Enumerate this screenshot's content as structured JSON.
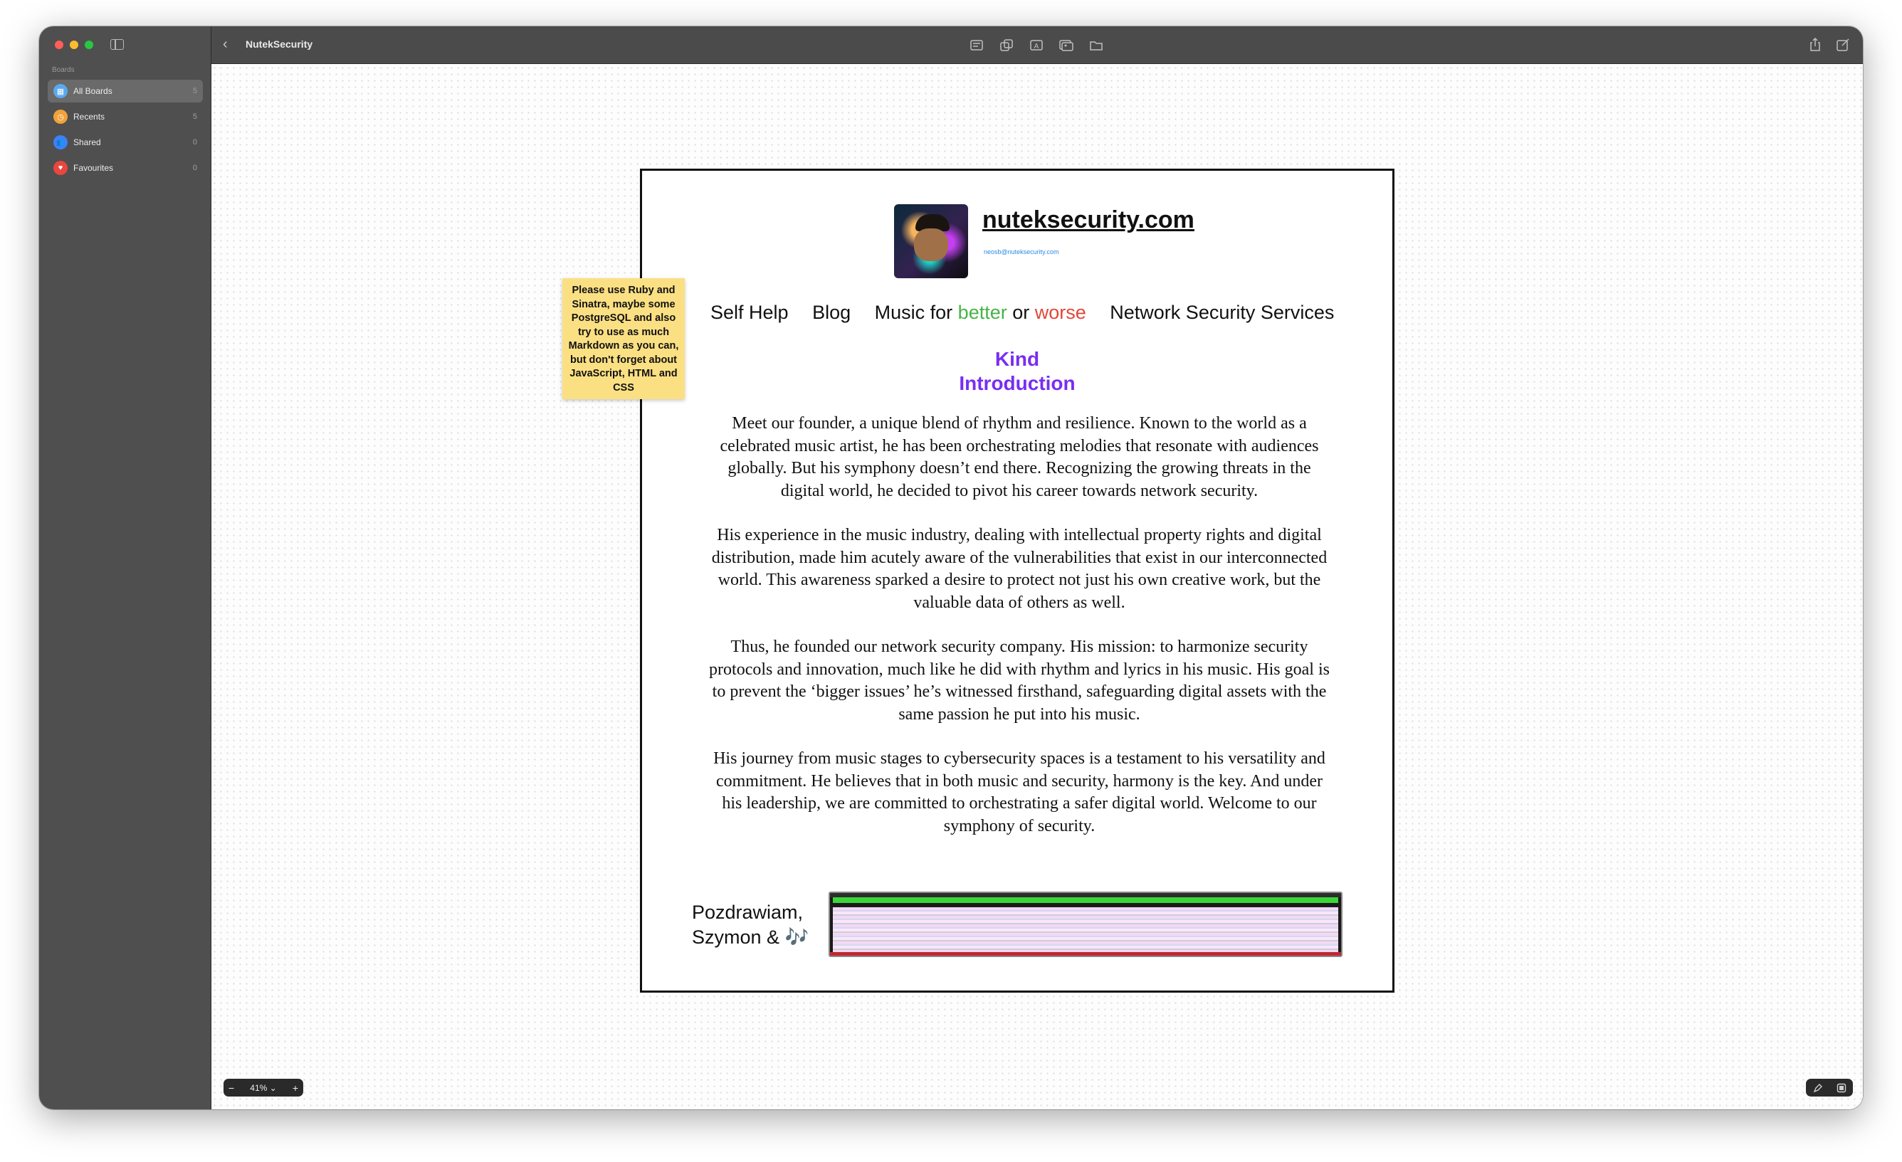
{
  "sidebar": {
    "heading": "Boards",
    "items": [
      {
        "label": "All Boards",
        "count": "5",
        "icon": "all-boards-icon",
        "color": "#5aa9ef",
        "glyph": "▦"
      },
      {
        "label": "Recents",
        "count": "5",
        "icon": "clock-icon",
        "color": "#f2a23a",
        "glyph": "◷"
      },
      {
        "label": "Shared",
        "count": "0",
        "icon": "people-icon",
        "color": "#3b82f6",
        "glyph": "👥"
      },
      {
        "label": "Favourites",
        "count": "0",
        "icon": "heart-icon",
        "color": "#e9463e",
        "glyph": "♥"
      }
    ]
  },
  "toolbar": {
    "title": "NutekSecurity",
    "back_glyph": "‹"
  },
  "document": {
    "site_name": "nuteksecurity.com",
    "email": "neosb@nuteksecurity.com",
    "nav": {
      "self_help": "Self Help",
      "blog": "Blog",
      "music_prefix": "Music for ",
      "better": "better",
      "or": " or ",
      "worse": "worse",
      "network": "Network Security Services"
    },
    "intro_line1": "Kind",
    "intro_line2": "Introduction",
    "paragraphs": [
      "Meet our founder, a unique blend of rhythm and resilience. Known to the world as a celebrated music artist, he has been orchestrating melodies that resonate with audiences globally. But his symphony doesn’t end there. Recognizing the growing threats in the digital world, he decided to pivot his career towards network security.",
      "His experience in the music industry, dealing with intellectual property rights and digital distribution, made him acutely aware of the vulnerabilities that exist in our interconnected world. This awareness sparked a desire to protect not just his own creative work, but the valuable data of others as well.",
      "Thus, he founded our network security company. His mission: to harmonize security protocols and innovation, much like he did with rhythm and lyrics in his music. His goal is to prevent the ‘bigger issues’ he’s witnessed firsthand, safeguarding digital assets with the same passion he put into his music.",
      "His journey from music stages to cybersecurity spaces is a testament to his versatility and commitment. He believes that in both music and security, harmony is the key. And under his leadership, we are committed to orchestrating a safer digital world. Welcome to our symphony of security."
    ],
    "signoff_line1": "Pozdrawiam,",
    "signoff_line2": "Szymon & 🎶"
  },
  "sticky_note": {
    "text": "Please use Ruby and Sinatra, maybe some PostgreSQL and also try to use as much Markdown as you can, but don't forget about JavaScript, HTML and CSS"
  },
  "zoom": {
    "value": "41%",
    "minus": "−",
    "plus": "+",
    "chevron": "⌄"
  },
  "colors": {
    "better": "#47b347",
    "worse": "#e0463a",
    "intro": "#7a2df1",
    "sticky": "#fbe083"
  }
}
